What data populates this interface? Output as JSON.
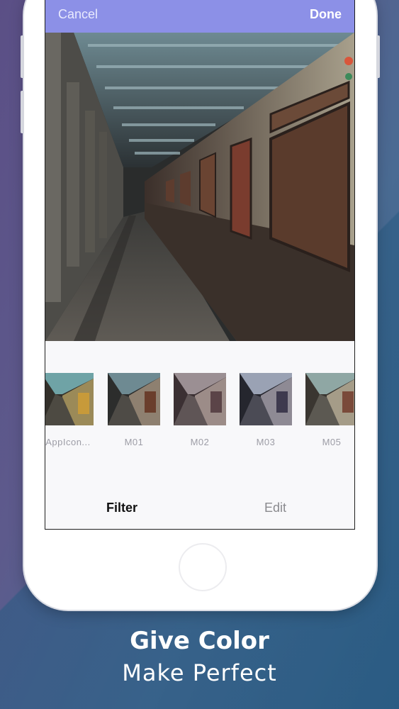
{
  "navbar": {
    "cancel_label": "Cancel",
    "done_label": "Done",
    "color": "#8c90e7"
  },
  "filters": [
    {
      "label": "AppIcon...",
      "tint": "warm-teal"
    },
    {
      "label": "M01",
      "tint": "natural"
    },
    {
      "label": "M02",
      "tint": "muted-pink"
    },
    {
      "label": "M03",
      "tint": "cool-blue"
    },
    {
      "label": "M05",
      "tint": "faded"
    }
  ],
  "tabs": {
    "filter_label": "Filter",
    "edit_label": "Edit"
  },
  "promo": {
    "line1": "Give Color",
    "line2": "Make Perfect"
  },
  "colors": {
    "accent": "#8c90e7",
    "background": "#4f5d8e"
  }
}
